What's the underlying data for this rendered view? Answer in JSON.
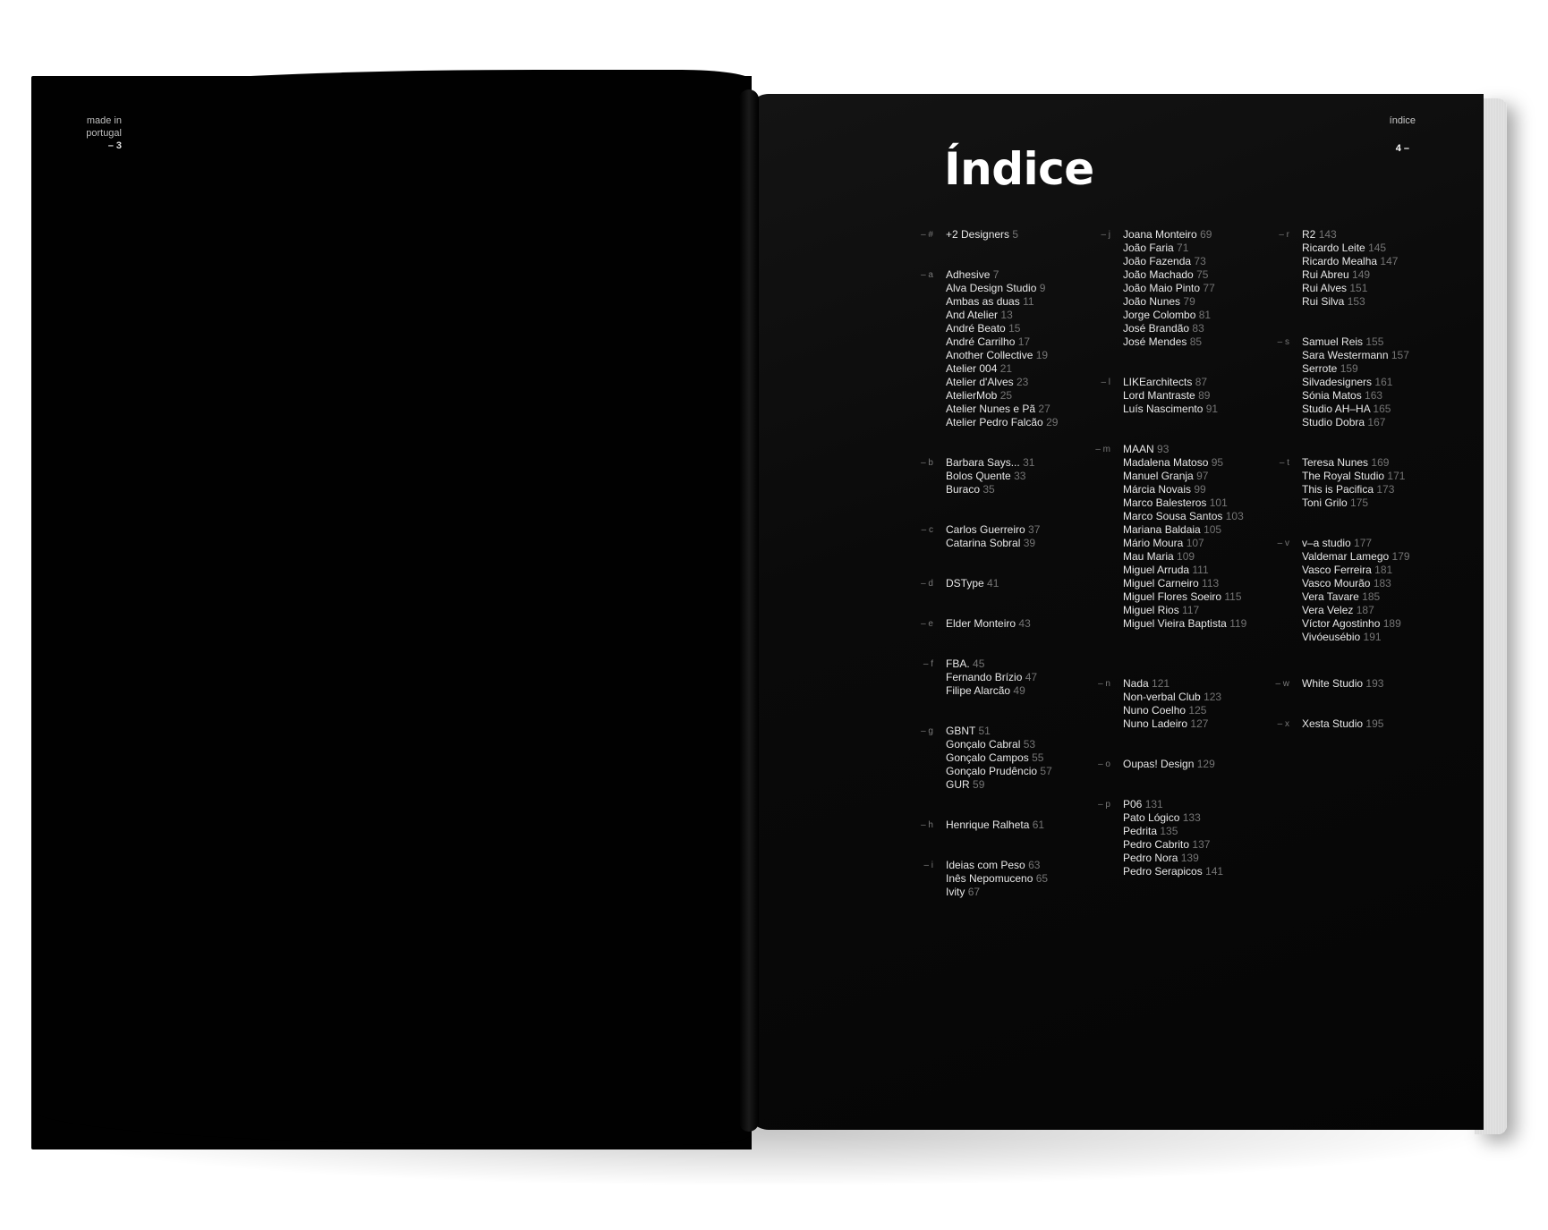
{
  "left_page": {
    "running_head": [
      "made in",
      "portugal"
    ],
    "page_number": "– 3"
  },
  "right_page": {
    "running_head": "índice",
    "page_number": "4 –",
    "title": "Índice"
  },
  "index": [
    {
      "letter": "– #",
      "entries": [
        {
          "name": "+2 Designers",
          "page": "5"
        }
      ]
    },
    {
      "letter": "– a",
      "entries": [
        {
          "name": "Adhesive",
          "page": "7"
        },
        {
          "name": "Alva Design Studio",
          "page": "9"
        },
        {
          "name": "Ambas as duas",
          "page": "11"
        },
        {
          "name": "And Atelier",
          "page": "13"
        },
        {
          "name": "André Beato",
          "page": "15"
        },
        {
          "name": "André Carrilho",
          "page": "17"
        },
        {
          "name": "Another Collective",
          "page": "19"
        },
        {
          "name": "Atelier 004",
          "page": "21"
        },
        {
          "name": "Atelier d'Alves",
          "page": "23"
        },
        {
          "name": "AtelierMob",
          "page": "25"
        },
        {
          "name": "Atelier Nunes e Pã",
          "page": "27"
        },
        {
          "name": "Atelier Pedro Falcão",
          "page": "29"
        }
      ]
    },
    {
      "letter": "– b",
      "entries": [
        {
          "name": "Barbara Says...",
          "page": "31"
        },
        {
          "name": "Bolos Quente",
          "page": "33"
        },
        {
          "name": "Buraco",
          "page": "35"
        }
      ]
    },
    {
      "letter": "– c",
      "entries": [
        {
          "name": "Carlos Guerreiro",
          "page": "37"
        },
        {
          "name": "Catarina Sobral",
          "page": "39"
        }
      ]
    },
    {
      "letter": "– d",
      "entries": [
        {
          "name": "DSType",
          "page": "41"
        }
      ]
    },
    {
      "letter": "– e",
      "entries": [
        {
          "name": "Elder Monteiro",
          "page": "43"
        }
      ]
    },
    {
      "letter": "– f",
      "entries": [
        {
          "name": "FBA.",
          "page": "45"
        },
        {
          "name": "Fernando Brízio",
          "page": "47"
        },
        {
          "name": "Filipe Alarcão",
          "page": "49"
        }
      ]
    },
    {
      "letter": "– g",
      "entries": [
        {
          "name": "GBNT",
          "page": "51"
        },
        {
          "name": "Gonçalo Cabral",
          "page": "53"
        },
        {
          "name": "Gonçalo Campos",
          "page": "55"
        },
        {
          "name": "Gonçalo Prudêncio",
          "page": "57"
        },
        {
          "name": "GUR",
          "page": "59"
        }
      ]
    },
    {
      "letter": "– h",
      "entries": [
        {
          "name": "Henrique Ralheta",
          "page": "61"
        }
      ]
    },
    {
      "letter": "– i",
      "entries": [
        {
          "name": "Ideias com Peso",
          "page": "63"
        },
        {
          "name": "Inês Nepomuceno",
          "page": "65"
        },
        {
          "name": "Ivity",
          "page": "67"
        }
      ]
    },
    {
      "letter": "– j",
      "entries": [
        {
          "name": "Joana Monteiro",
          "page": "69"
        },
        {
          "name": "João Faria",
          "page": "71"
        },
        {
          "name": "João Fazenda",
          "page": "73"
        },
        {
          "name": "João Machado",
          "page": "75"
        },
        {
          "name": "João Maio Pinto",
          "page": "77"
        },
        {
          "name": "João Nunes",
          "page": "79"
        },
        {
          "name": "Jorge Colombo",
          "page": "81"
        },
        {
          "name": "José Brandão",
          "page": "83"
        },
        {
          "name": "José Mendes",
          "page": "85"
        }
      ]
    },
    {
      "letter": "– l",
      "entries": [
        {
          "name": "LIKEarchitects",
          "page": "87"
        },
        {
          "name": "Lord Mantraste",
          "page": "89"
        },
        {
          "name": "Luís Nascimento",
          "page": "91"
        }
      ]
    },
    {
      "letter": "– m",
      "entries": [
        {
          "name": "MAAN",
          "page": "93"
        },
        {
          "name": "Madalena Matoso",
          "page": "95"
        },
        {
          "name": "Manuel Granja",
          "page": "97"
        },
        {
          "name": "Márcia Novais",
          "page": "99"
        },
        {
          "name": "Marco Balesteros",
          "page": "101"
        },
        {
          "name": "Marco Sousa Santos",
          "page": "103"
        },
        {
          "name": "Mariana Baldaia",
          "page": "105"
        },
        {
          "name": "Mário Moura",
          "page": "107"
        },
        {
          "name": "Mau Maria",
          "page": "109"
        },
        {
          "name": "Miguel Arruda",
          "page": "111"
        },
        {
          "name": "Miguel Carneiro",
          "page": "113"
        },
        {
          "name": "Miguel Flores Soeiro",
          "page": "115"
        },
        {
          "name": "Miguel Rios",
          "page": "117"
        },
        {
          "name": "Miguel Vieira Baptista",
          "page": "119"
        }
      ]
    },
    {
      "letter": "– n",
      "entries": [
        {
          "name": "Nada",
          "page": "121"
        },
        {
          "name": "Non-verbal Club",
          "page": "123"
        },
        {
          "name": "Nuno Coelho",
          "page": "125"
        },
        {
          "name": "Nuno Ladeiro",
          "page": "127"
        }
      ]
    },
    {
      "letter": "– o",
      "entries": [
        {
          "name": "Oupas! Design",
          "page": "129"
        }
      ]
    },
    {
      "letter": "– p",
      "entries": [
        {
          "name": "P06",
          "page": "131"
        },
        {
          "name": "Pato Lógico",
          "page": "133"
        },
        {
          "name": "Pedrita",
          "page": "135"
        },
        {
          "name": "Pedro Cabrito",
          "page": "137"
        },
        {
          "name": "Pedro Nora",
          "page": "139"
        },
        {
          "name": "Pedro Serapicos",
          "page": "141"
        }
      ]
    },
    {
      "letter": "– r",
      "entries": [
        {
          "name": "R2",
          "page": "143"
        },
        {
          "name": "Ricardo Leite",
          "page": "145"
        },
        {
          "name": "Ricardo Mealha",
          "page": "147"
        },
        {
          "name": "Rui Abreu",
          "page": "149"
        },
        {
          "name": "Rui Alves",
          "page": "151"
        },
        {
          "name": "Rui Silva",
          "page": "153"
        }
      ]
    },
    {
      "letter": "– s",
      "entries": [
        {
          "name": "Samuel Reis",
          "page": "155"
        },
        {
          "name": "Sara Westermann",
          "page": "157"
        },
        {
          "name": "Serrote",
          "page": "159"
        },
        {
          "name": "Silvadesigners",
          "page": "161"
        },
        {
          "name": "Sónia Matos",
          "page": "163"
        },
        {
          "name": "Studio AH–HA",
          "page": "165"
        },
        {
          "name": "Studio Dobra",
          "page": "167"
        }
      ]
    },
    {
      "letter": "– t",
      "entries": [
        {
          "name": "Teresa Nunes",
          "page": "169"
        },
        {
          "name": "The Royal Studio",
          "page": "171"
        },
        {
          "name": "This is Pacifica",
          "page": "173"
        },
        {
          "name": "Toni Grilo",
          "page": "175"
        }
      ]
    },
    {
      "letter": "– v",
      "entries": [
        {
          "name": "v–a studio",
          "page": "177"
        },
        {
          "name": "Valdemar Lamego",
          "page": "179"
        },
        {
          "name": "Vasco Ferreira",
          "page": "181"
        },
        {
          "name": "Vasco Mourão",
          "page": "183"
        },
        {
          "name": "Vera Tavare",
          "page": "185"
        },
        {
          "name": "Vera Velez",
          "page": "187"
        },
        {
          "name": "Víctor Agostinho",
          "page": "189"
        },
        {
          "name": "Vivóeusébio",
          "page": "191"
        }
      ]
    },
    {
      "letter": "– w",
      "entries": [
        {
          "name": "White Studio",
          "page": "193"
        }
      ]
    },
    {
      "letter": "– x",
      "entries": [
        {
          "name": "Xesta Studio",
          "page": "195"
        }
      ]
    }
  ]
}
